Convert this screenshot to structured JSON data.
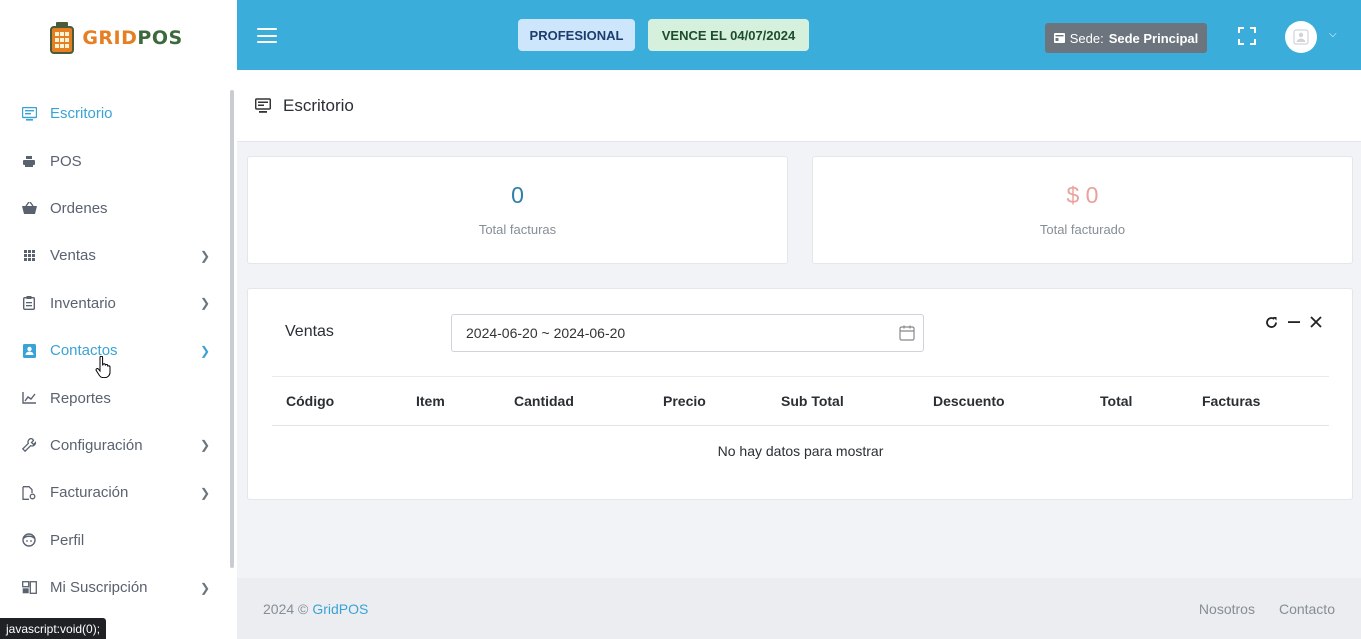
{
  "brand": {
    "part1": "GRID",
    "part2": "POS"
  },
  "sidebar": {
    "items": [
      {
        "label": "Escritorio",
        "icon": "desktop-icon",
        "active": true
      },
      {
        "label": "POS",
        "icon": "printer-icon"
      },
      {
        "label": "Ordenes",
        "icon": "basket-icon"
      },
      {
        "label": "Ventas",
        "icon": "grid-icon",
        "submenu": true
      },
      {
        "label": "Inventario",
        "icon": "clipboard-icon",
        "submenu": true
      },
      {
        "label": "Contactos",
        "icon": "contact-card-icon",
        "submenu": true
      },
      {
        "label": "Reportes",
        "icon": "line-chart-icon"
      },
      {
        "label": "Configuración",
        "icon": "wrench-icon",
        "submenu": true
      },
      {
        "label": "Facturación",
        "icon": "file-settings-icon",
        "submenu": true
      },
      {
        "label": "Perfil",
        "icon": "face-icon"
      },
      {
        "label": "Mi Suscripción",
        "icon": "subscription-icon",
        "submenu": true
      }
    ]
  },
  "topbar": {
    "plan_badge": "PROFESIONAL",
    "expiry_badge": "VENCE EL 04/07/2024",
    "sede_label": "Sede:",
    "sede_value": "Sede Principal"
  },
  "page": {
    "title": "Escritorio"
  },
  "stats": [
    {
      "value": "0",
      "label": "Total facturas"
    },
    {
      "value": "$ 0",
      "label": "Total facturado"
    }
  ],
  "sales": {
    "title": "Ventas",
    "date_range": "2024-06-20 ~ 2024-06-20",
    "columns": [
      "Código",
      "Item",
      "Cantidad",
      "Precio",
      "Sub Total",
      "Descuento",
      "Total",
      "Facturas"
    ],
    "empty_message": "No hay datos para mostrar"
  },
  "footer": {
    "copyright": "2024 ©",
    "brand_link": "GridPOS",
    "links": [
      "Nosotros",
      "Contacto"
    ]
  },
  "statusbar": {
    "text": "javascript:void(0);"
  },
  "colors": {
    "topbar": "#3aaddb",
    "accent": "#3aa3d6",
    "plan_badge_bg": "#cde6fb",
    "expiry_badge_bg": "#d5f0dd",
    "sede_button_bg": "#6c757d",
    "stat_value_blue": "#2c7fa8",
    "stat_value_pink": "#eba19b"
  }
}
